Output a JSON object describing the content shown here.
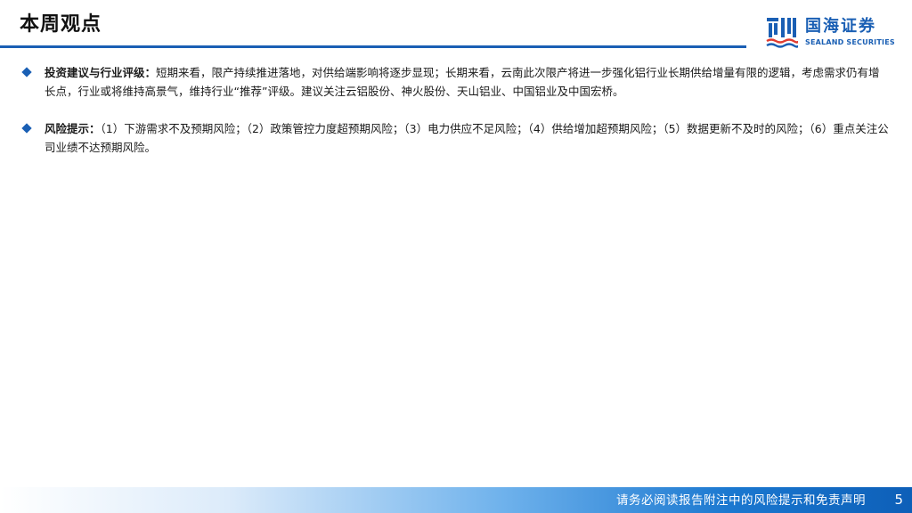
{
  "header": {
    "title": "本周观点",
    "logo": {
      "cn": "国海证券",
      "en": "SEALAND SECURITIES"
    }
  },
  "bullets": [
    {
      "label": "投资建议与行业评级：",
      "text": "短期来看，限产持续推进落地，对供给端影响将逐步显现；长期来看，云南此次限产将进一步强化铝行业长期供给增量有限的逻辑，考虑需求仍有增长点，行业或将维持高景气，维持行业“推荐”评级。建议关注云铝股份、神火股份、天山铝业、中国铝业及中国宏桥。"
    },
    {
      "label": "风险提示：",
      "text": "（1）下游需求不及预期风险；（2）政策管控力度超预期风险；（3）电力供应不足风险；（4）供给增加超预期风险；（5）数据更新不及时的风险；（6）重点关注公司业绩不达预期风险。"
    }
  ],
  "footer": {
    "disclaimer": "请务必阅读报告附注中的风险提示和免责声明",
    "page_number": "5"
  },
  "colors": {
    "brand_blue": "#1a5fb4"
  }
}
